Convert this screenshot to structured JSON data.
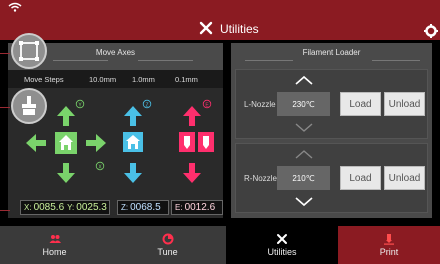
{
  "header": {
    "title": "Utilities",
    "title_icon": "tools-icon",
    "settings_icon": "gear-icon",
    "status_icon": "wifi-icon"
  },
  "move_axes": {
    "title": "Move Axes",
    "steps_label": "Move Steps",
    "steps": [
      "10.0mm",
      "1.0mm",
      "0.1mm"
    ],
    "axis_badges": {
      "y": "Y",
      "x": "X",
      "z": "Z",
      "e": "E"
    },
    "readouts": {
      "x_label": "X:",
      "x_value": "0085.6",
      "y_label": "Y:",
      "y_value": "0025.3",
      "z_label": "Z:",
      "z_value": "0068.5",
      "e_label": "E:",
      "e_value": "0012.6"
    }
  },
  "filament_loader": {
    "title": "Filament Loader",
    "nozzles": [
      {
        "label": "L-Nozzle",
        "temp": "230℃",
        "load": "Load",
        "unload": "Unload"
      },
      {
        "label": "R-Nozzle",
        "temp": "210℃",
        "load": "Load",
        "unload": "Unload"
      }
    ]
  },
  "bottom_nav": [
    {
      "label": "Home",
      "icon": "users-icon"
    },
    {
      "label": "Tune",
      "icon": "pie-chart-icon"
    },
    {
      "label": "Utilities",
      "icon": "tools-icon"
    },
    {
      "label": "Print",
      "icon": "print-icon"
    }
  ],
  "colors": {
    "header": "#8b1b22",
    "x_axis": "#7ad36b",
    "z_axis": "#4ac0e6",
    "e_axis": "#ff2f6d",
    "panel": "#4a4a4a"
  }
}
